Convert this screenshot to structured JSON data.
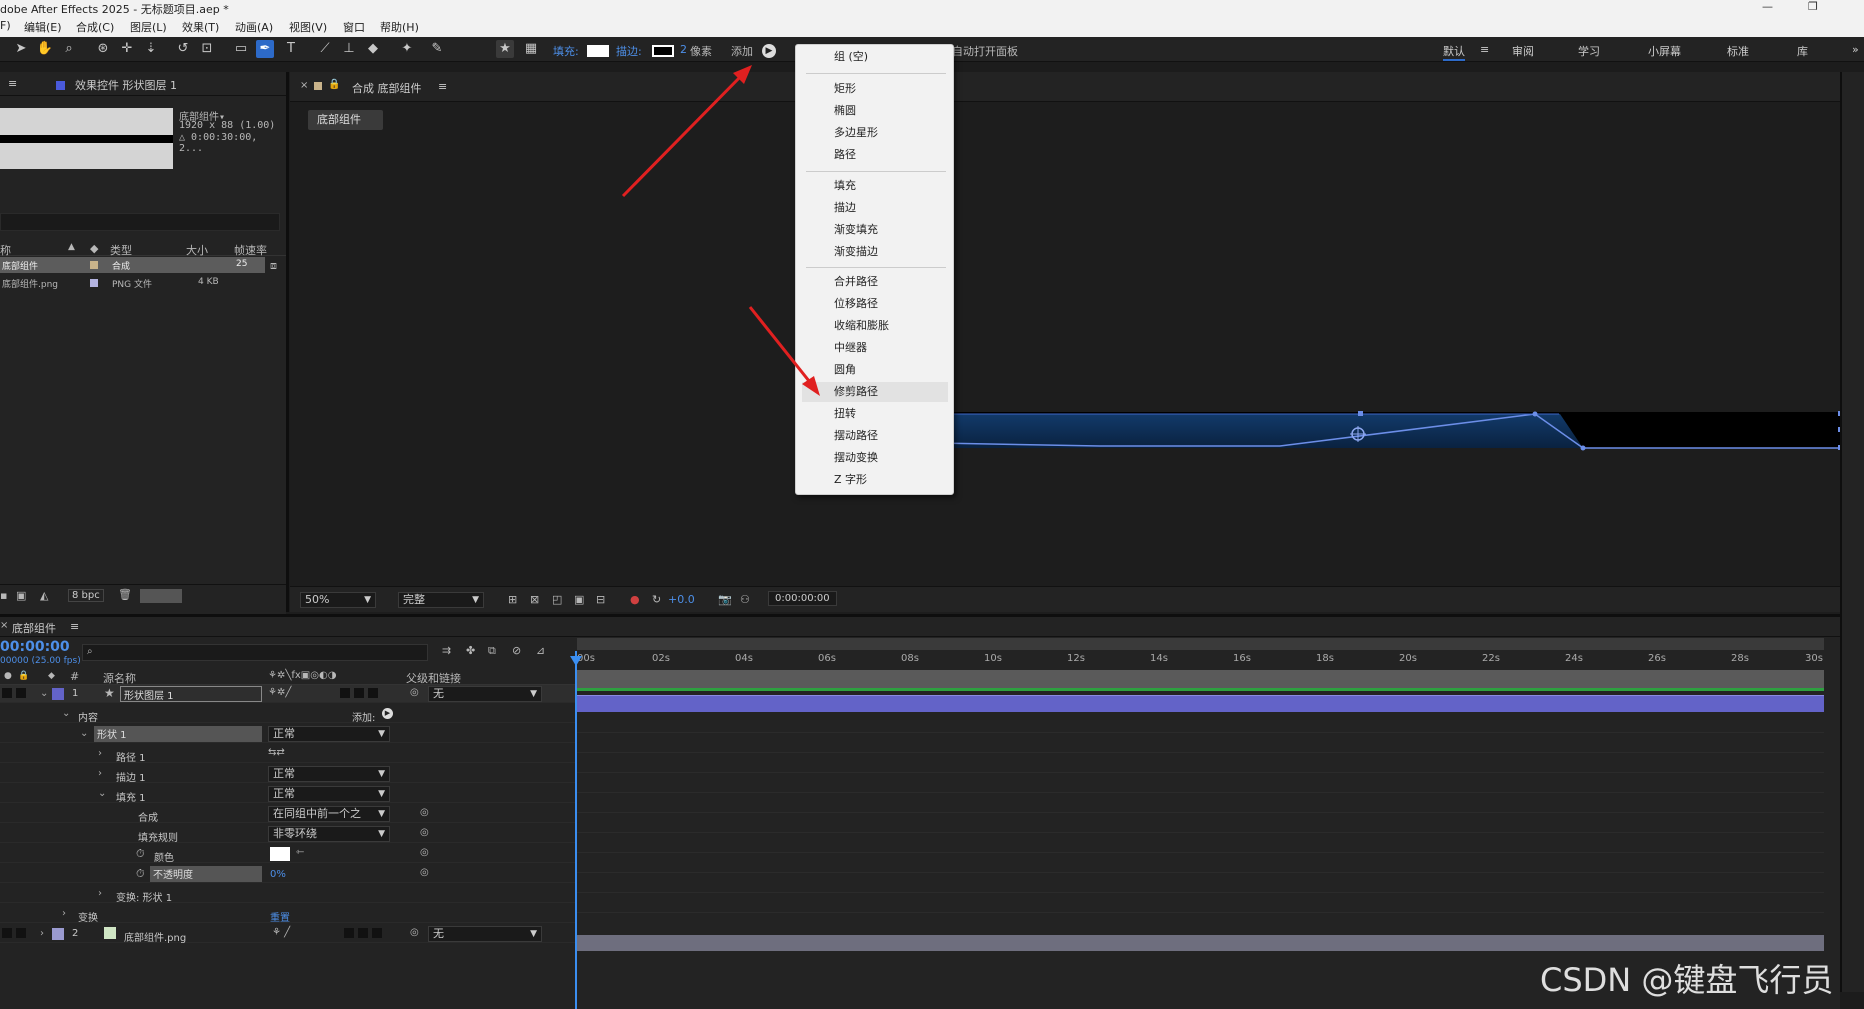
{
  "app": {
    "title": "dobe After Effects 2025 - 无标题项目.aep *"
  },
  "menubar": [
    "F)",
    "编辑(E)",
    "合成(C)",
    "图层(L)",
    "效果(T)",
    "动画(A)",
    "视图(V)",
    "窗口",
    "帮助(H)"
  ],
  "toolbar": {
    "fill_label": "填充:",
    "stroke_label": "描边:",
    "stroke_width": "2",
    "stroke_unit": "像素",
    "add_label": "添加",
    "auto_open": "自动打开面板",
    "workspaces": [
      "默认",
      "审阅",
      "学习",
      "小屏幕",
      "标准",
      "库"
    ]
  },
  "project_panel": {
    "tab": "效果控件 形状图层 1",
    "thumb_name": "底部组件▾",
    "thumb_info1": "1920 x 88 (1.00)",
    "thumb_info2": "△ 0:00:30:00, 2...",
    "columns": [
      "称",
      "类型",
      "大小",
      "帧速率"
    ],
    "rows": [
      {
        "name": "底部组件",
        "type": "合成",
        "size": "",
        "rate": "25"
      },
      {
        "name": "底部组件.png",
        "type": "PNG 文件",
        "size": "4 KB",
        "rate": ""
      }
    ],
    "bpc": "8 bpc"
  },
  "comp_panel": {
    "tab": "合成 底部组件",
    "button": "底部组件",
    "zoom": "50%",
    "quality": "完整",
    "exposure": "+0.0",
    "timecode": "0:00:00:00"
  },
  "add_menu": {
    "groups": [
      [
        "组 (空)"
      ],
      [
        "矩形",
        "椭圆",
        "多边星形",
        "路径"
      ],
      [
        "填充",
        "描边",
        "渐变填充",
        "渐变描边"
      ],
      [
        "合并路径",
        "位移路径",
        "收缩和膨胀",
        "中继器",
        "圆角",
        "修剪路径",
        "扭转",
        "摆动路径",
        "摆动变换",
        "Z 字形"
      ]
    ],
    "highlighted": "修剪路径"
  },
  "timeline": {
    "tab": "底部组件",
    "timecode": "00:00:00",
    "fps": "00000 (25.00 fps)",
    "search_placeholder": "",
    "col_num": "#",
    "col_source": "源名称",
    "col_parent": "父级和链接",
    "ticks": [
      "00s",
      "02s",
      "04s",
      "06s",
      "08s",
      "10s",
      "12s",
      "14s",
      "16s",
      "18s",
      "20s",
      "22s",
      "24s",
      "26s",
      "28s",
      "30s"
    ],
    "layers": [
      {
        "num": "1",
        "name": "形状图层 1",
        "parent": "无"
      },
      {
        "num": "2",
        "name": "底部组件.png",
        "parent": "无"
      }
    ],
    "props": {
      "contents": "内容",
      "add": "添加:",
      "shape": "形状 1",
      "shape_mode": "正常",
      "path": "路径 1",
      "stroke": "描边 1",
      "stroke_mode": "正常",
      "fill": "填充 1",
      "fill_mode": "正常",
      "composite": "合成",
      "composite_val": "在同组中前一个之",
      "fill_rule": "填充规则",
      "fill_rule_val": "非零环绕",
      "color": "颜色",
      "opacity": "不透明度",
      "opacity_val": "0%",
      "transform_shape": "变换: 形状 1",
      "transform": "变换",
      "reset": "重置"
    }
  },
  "watermark": "CSDN @键盘飞行员",
  "colors": {
    "accent": "#2d6ac8",
    "layer_bar": "#6363c8",
    "layer2_bar": "#6e6e7e",
    "arrow": "#e02020"
  }
}
